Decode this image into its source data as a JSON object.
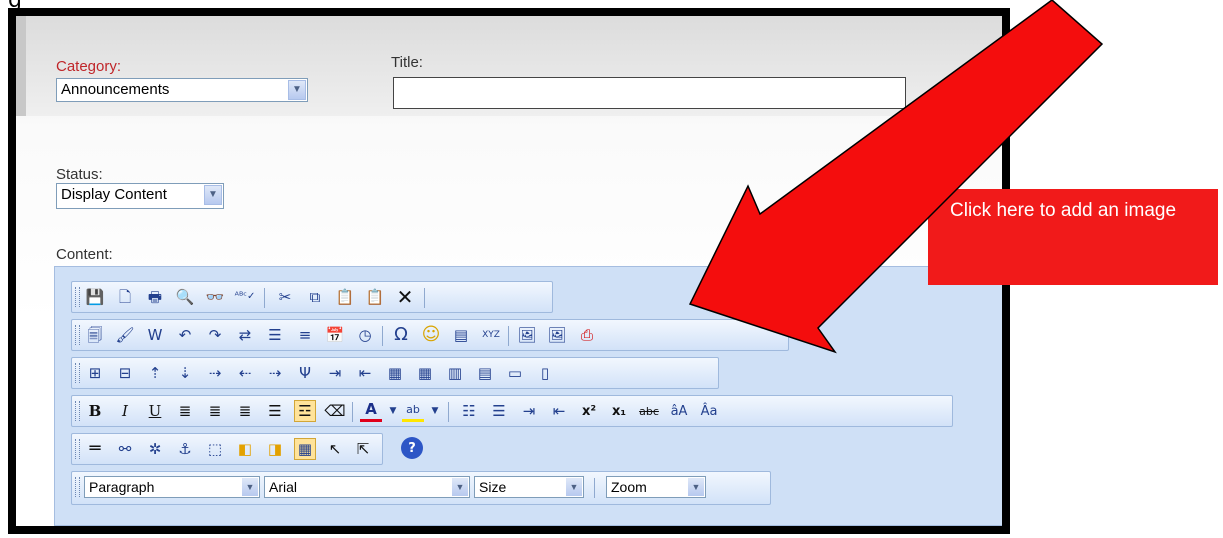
{
  "form": {
    "category_label": "Category:",
    "category_value": "Announcements",
    "title_label": "Title:",
    "title_value": "",
    "status_label": "Status:",
    "status_value": "Display Content",
    "content_label": "Content:"
  },
  "toolbar_row1": [
    "save-icon",
    "new-document-icon",
    "print-icon",
    "preview-icon",
    "find-icon",
    "spellcheck-icon",
    "cut-icon",
    "copy-icon",
    "paste-icon",
    "paste-text-icon",
    "delete-icon"
  ],
  "toolbar_row2": [
    "template-icon",
    "format-brush-icon",
    "paste-word-icon",
    "undo-icon",
    "redo-icon",
    "replace-icon",
    "indent-list-icon",
    "horizontal-rule-icon",
    "insert-date-icon",
    "insert-time-icon",
    "special-character-icon",
    "emoticon-icon",
    "insert-snippet-icon",
    "insert-custom-tag-icon",
    "insert-image-icon",
    "image-properties-icon",
    "pdf-icon"
  ],
  "toolbar_row5": [
    "horizontal-line-icon",
    "link-icon",
    "unlink-icon",
    "anchor-icon",
    "select-object-icon",
    "bring-forward-icon",
    "send-backward-icon",
    "show-grid-icon",
    "absolute-position-icon",
    "static-position-icon",
    "help-icon"
  ],
  "format": {
    "paragraph": "Paragraph",
    "font": "Arial",
    "size": "Size",
    "zoom": "Zoom"
  },
  "callout": {
    "text": "Click here to add an image"
  },
  "colors": {
    "callout": "#f11a1a",
    "arrow": "#f40d0d",
    "editor_bg": "#cfe0f6"
  }
}
